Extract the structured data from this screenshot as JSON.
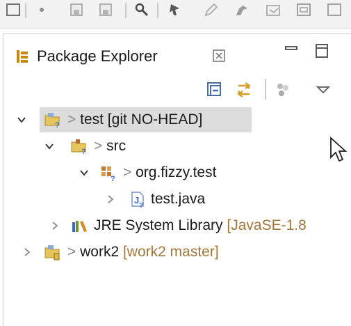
{
  "colors": {
    "selection": "#dcdcdc",
    "branch_text": "#a2773a",
    "decorator": "#8a8a8a",
    "folder": "#e0b84a",
    "git_badge": "#3a6fd1"
  },
  "toolbar": {
    "icons": [
      "new-file-icon",
      "open-type-icon",
      "save-all-icon",
      "search-icon",
      "run-icon",
      "pen-icon",
      "debug-icon",
      "open-perspective-icon",
      "window-icon"
    ]
  },
  "view": {
    "tab": {
      "title": "Package Explorer",
      "close_glyph": "⊠"
    },
    "controls": [
      "minimize-icon",
      "maximize-icon"
    ],
    "toolbar_icons": [
      "collapse-all-icon",
      "link-with-editor-icon",
      "focus-icon",
      "view-menu-icon"
    ]
  },
  "tree": {
    "nodes": [
      {
        "prefix": "> ",
        "name": "test",
        "suffix": " [git NO-HEAD]",
        "expanded": true,
        "selected": true,
        "icon": "project-icon"
      },
      {
        "prefix": "> ",
        "name": "src",
        "suffix": "",
        "expanded": true,
        "icon": "source-folder-icon"
      },
      {
        "prefix": "> ",
        "name": "org.fizzy.test",
        "suffix": "",
        "expanded": true,
        "icon": "package-icon"
      },
      {
        "prefix": "",
        "name": "test.java",
        "suffix": "",
        "expanded": false,
        "icon": "java-file-icon"
      },
      {
        "prefix": "",
        "name": "JRE System Library",
        "suffix": " [JavaSE-1.8",
        "expanded": false,
        "icon": "library-icon"
      },
      {
        "prefix": "> ",
        "name": "work2",
        "suffix": " [work2 master]",
        "expanded": false,
        "icon": "project-icon"
      }
    ]
  }
}
